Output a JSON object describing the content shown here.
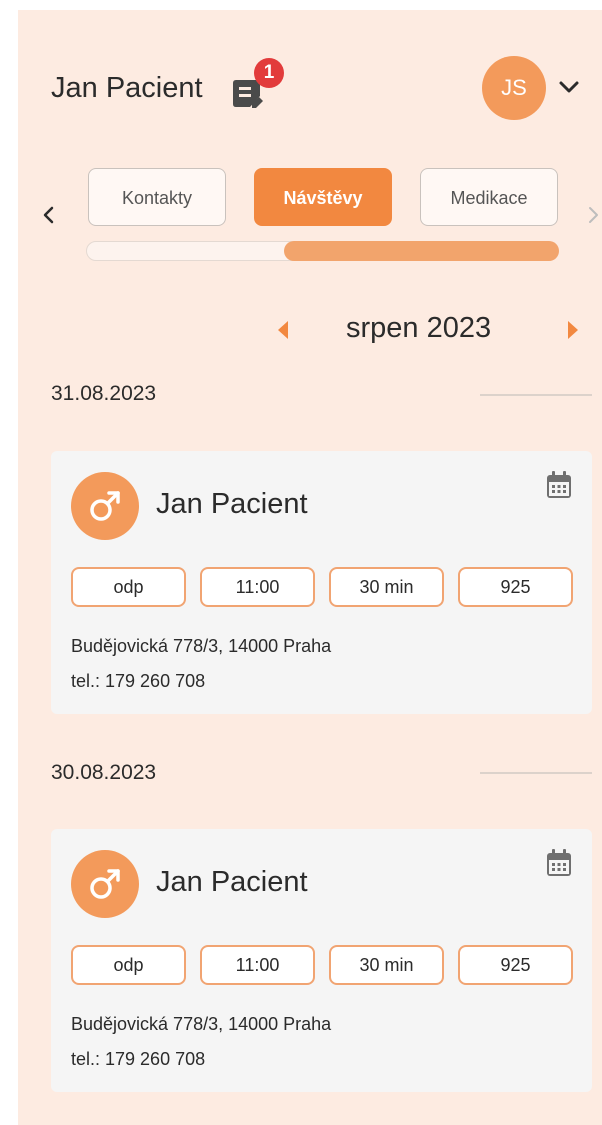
{
  "header": {
    "user_name": "Jan Pacient",
    "notification_count": "1",
    "avatar_initials": "JS"
  },
  "tabs": [
    {
      "label": "Kontakty",
      "active": false
    },
    {
      "label": "Návštěvy",
      "active": true
    },
    {
      "label": "Medikace",
      "active": false
    }
  ],
  "tab_scroll": {
    "position_fraction": 0.42,
    "visible_fraction": 0.58
  },
  "calendar": {
    "month_label": "srpen 2023"
  },
  "visits": [
    {
      "date": "31.08.2023",
      "patient_name": "Jan Pacient",
      "gender_icon": "male-icon",
      "chips": [
        "odp",
        "11:00",
        "30 min",
        "925"
      ],
      "address": "Budějovická 778/3, 14000 Praha",
      "phone": "tel.: 179 260 708"
    },
    {
      "date": "30.08.2023",
      "patient_name": "Jan Pacient",
      "gender_icon": "male-icon",
      "chips": [
        "odp",
        "11:00",
        "30 min",
        "925"
      ],
      "address": "Budějovická 778/3, 14000 Praha",
      "phone": "tel.: 179 260 708"
    }
  ],
  "colors": {
    "accent": "#f28840",
    "avatar": "#f39a5b",
    "badge": "#e23b3b",
    "background": "#fdebe1",
    "card": "#f5f5f5"
  }
}
